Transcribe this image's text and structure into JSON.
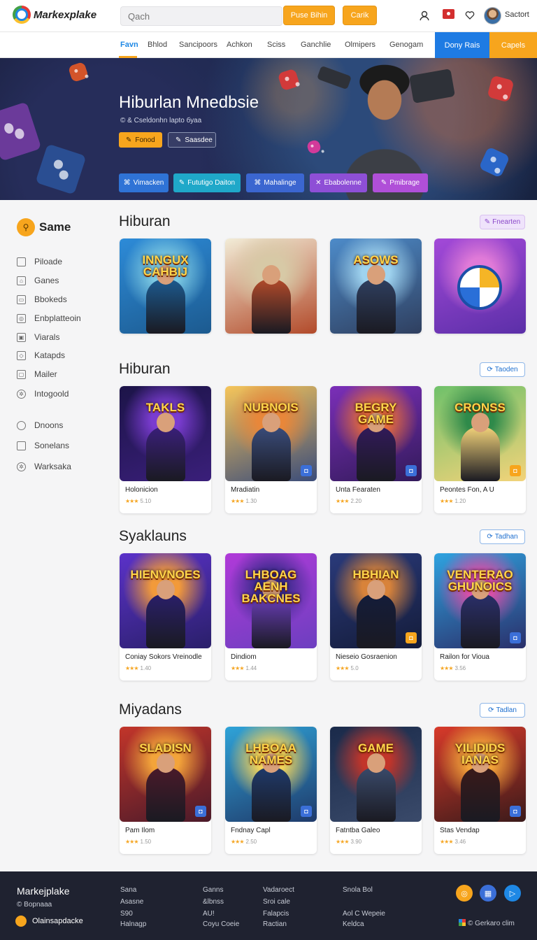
{
  "header": {
    "logo_text": "Markexplake",
    "search_placeholder": "Qach",
    "btn_primary": "Puse Bihin",
    "btn_secondary": "Carik",
    "user_name": "Sactort",
    "icons": [
      "person-icon",
      "flag-icon",
      "heart-icon"
    ]
  },
  "nav": {
    "items": [
      "Favn",
      "Bhlod",
      "Sancipoors",
      "Achkon",
      "Sciss",
      "Ganchlie",
      "Olmipers",
      "Genogam"
    ],
    "active_index": 0,
    "cta_blue": "Dony Rais",
    "cta_orange": "Capels"
  },
  "hero": {
    "title": "Hiburlan Mnedbsie",
    "subtitle": "© & Cseldonhn lapto буаа",
    "play_label": "Fonod",
    "share_label": "Saasdee",
    "chips": [
      {
        "label": "Vimacken",
        "color": "#2f73d6"
      },
      {
        "label": "Fututigo Daiton",
        "color": "#1fa8c9"
      },
      {
        "label": "Mahalinge",
        "color": "#3b66d0"
      },
      {
        "label": "Ebabolenne",
        "color": "#8e4fd6"
      },
      {
        "label": "Pmibrage",
        "color": "#b04fd8"
      }
    ]
  },
  "sidebar": {
    "heading": "Same",
    "items": [
      "Piloade",
      "Ganes",
      "Bbokeds",
      "Enbplatteoin",
      "Viarals",
      "Katapds",
      "Mailer",
      "Intogoold"
    ],
    "items_bottom": [
      "Dnoons",
      "Sonelans",
      "Warksaka"
    ]
  },
  "sections": [
    {
      "title": "Hiburan",
      "button": "Fnearten",
      "button_style": "purple",
      "cards": [
        {
          "art_text": "INNGUX CAHBIJ",
          "name": "",
          "rating": "",
          "palette": [
            "#2d8bd8",
            "#7ecbe3",
            "#1c5a8f"
          ],
          "badge": ""
        },
        {
          "art_text": "",
          "name": "",
          "rating": "",
          "palette": [
            "#f2ecd7",
            "#d7c9a6",
            "#b24a2a"
          ],
          "badge": ""
        },
        {
          "art_text": "ASOWS",
          "name": "",
          "rating": "",
          "palette": [
            "#4d8bc9",
            "#9fd3ef",
            "#2f3f5f"
          ],
          "badge": ""
        },
        {
          "art_text": "",
          "name": "",
          "rating": "",
          "palette": [
            "#a349d8",
            "#e07ad8",
            "#5b2fa8"
          ],
          "badge": ""
        }
      ]
    },
    {
      "title": "Hiburan",
      "button": "Taoden",
      "button_style": "blue",
      "cards": [
        {
          "art_text": "TAKLS",
          "name": "Holonicion",
          "rating": "5.10",
          "palette": [
            "#1c1448",
            "#7a3cd0",
            "#3a1f7a"
          ],
          "badge": ""
        },
        {
          "art_text": "NUBNOIS",
          "name": "Mradiatin",
          "rating": "1.30",
          "palette": [
            "#f6c55a",
            "#e8873a",
            "#3a4c7a"
          ],
          "badge": "blue"
        },
        {
          "art_text": "BEGRY GAME",
          "name": "Unta Fearaten",
          "rating": "2.20",
          "palette": [
            "#7b2fb8",
            "#e46a3c",
            "#321a5a"
          ],
          "badge": "blue"
        },
        {
          "art_text": "CRONSS",
          "name": "Peontes Fon, A U",
          "rating": "1.20",
          "palette": [
            "#6fc16a",
            "#2f8a4a",
            "#f3d37a"
          ],
          "badge": "orange"
        }
      ]
    },
    {
      "title": "Syaklauns",
      "button": "Tadhan",
      "button_style": "blue",
      "cards": [
        {
          "art_text": "HIENVNOES",
          "name": "Coniay Sokors Vreinodle",
          "rating": "1.40",
          "palette": [
            "#5b32c9",
            "#f29a3a",
            "#2a1f6a"
          ],
          "badge": ""
        },
        {
          "art_text": "LHBOAG AENH BAKCNES",
          "name": "Dindiom",
          "rating": "1.44",
          "palette": [
            "#b03ad8",
            "#3a2a8a",
            "#6d3fc0"
          ],
          "badge": ""
        },
        {
          "art_text": "HBHIAN",
          "name": "Nieseio Gosraenion",
          "rating": "5.0",
          "palette": [
            "#2a3a7a",
            "#d8833a",
            "#141c3a"
          ],
          "badge": "orange"
        },
        {
          "art_text": "VENTERAO GHUNOICS",
          "name": "Railon for Vioua",
          "rating": "3.56",
          "palette": [
            "#2fa3e0",
            "#d84fa8",
            "#2a2f6a"
          ],
          "badge": "blue"
        }
      ]
    },
    {
      "title": "Miyadans",
      "button": "Tadlan",
      "button_style": "blue",
      "cards": [
        {
          "art_text": "SLADISN",
          "name": "Pam Ilom",
          "rating": "1.50",
          "palette": [
            "#c2352a",
            "#f3a43a",
            "#4a1a2a"
          ],
          "badge": "blue"
        },
        {
          "art_text": "LHBOAA NAMES",
          "name": "Fndnay Capl",
          "rating": "2.50",
          "palette": [
            "#2fa3d8",
            "#f3d35a",
            "#1f3a6a"
          ],
          "badge": "blue"
        },
        {
          "art_text": "GAME",
          "name": "Fatntba Galeo",
          "rating": "3.90",
          "palette": [
            "#1a2a4a",
            "#c2352a",
            "#3a4a6a"
          ],
          "badge": ""
        },
        {
          "art_text": "YILIDIDS IANAS",
          "name": "Stas Vendap",
          "rating": "3.46",
          "palette": [
            "#d83a2a",
            "#f3a43a",
            "#3a1a1a"
          ],
          "badge": "blue"
        }
      ]
    }
  ],
  "footer": {
    "brand": "Markejplake",
    "subtitle": "© Bopnaaa",
    "app_label": "Olainsapdacke",
    "col1": [
      "Sana",
      "Asasne",
      "S90",
      "Halnagp"
    ],
    "col2": [
      "Ganns",
      "&lbnss",
      "AU!",
      "Coyu Coeie"
    ],
    "col3": [
      "Vadaroect",
      "Sroi cale",
      "Falapcis",
      "Ractian"
    ],
    "col4": [
      "Snola Bol",
      "",
      "Aol C Wepeie",
      "Keldca"
    ],
    "copyright": "Gerkaro clim"
  }
}
